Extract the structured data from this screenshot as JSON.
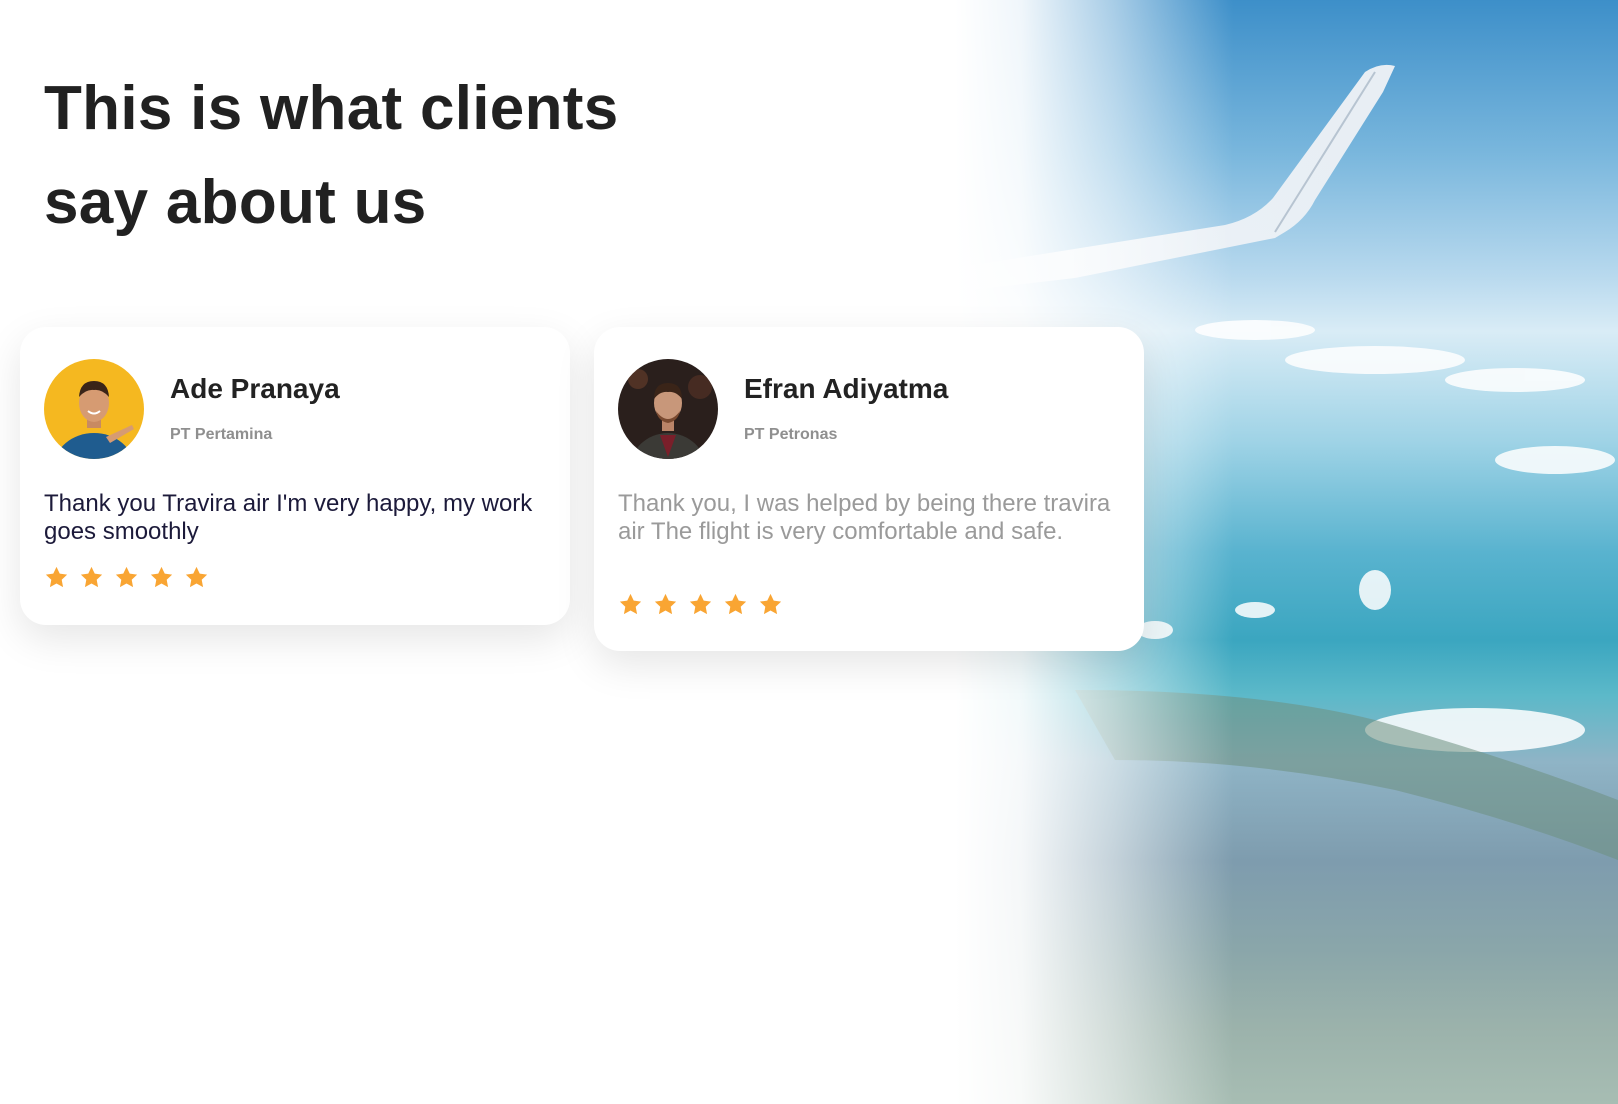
{
  "heading": {
    "line1": "This is what clients",
    "line2": "say about us"
  },
  "testimonials": [
    {
      "name": "Ade Pranaya",
      "company": "PT Pertamina",
      "quote": "Thank you Travira air I'm very happy, my work goes smoothly",
      "rating": 5
    },
    {
      "name": "Efran Adiyatma",
      "company": "PT Petronas",
      "quote": "Thank you, I was helped by being there travira air The flight is very comfortable and safe.",
      "rating": 5
    }
  ],
  "colors": {
    "heading": "#212121",
    "star": "#F9A533",
    "avatar1_bg": "#F5B820"
  },
  "icons": {
    "star": "star-icon",
    "wing": "airplane-wing-image"
  }
}
